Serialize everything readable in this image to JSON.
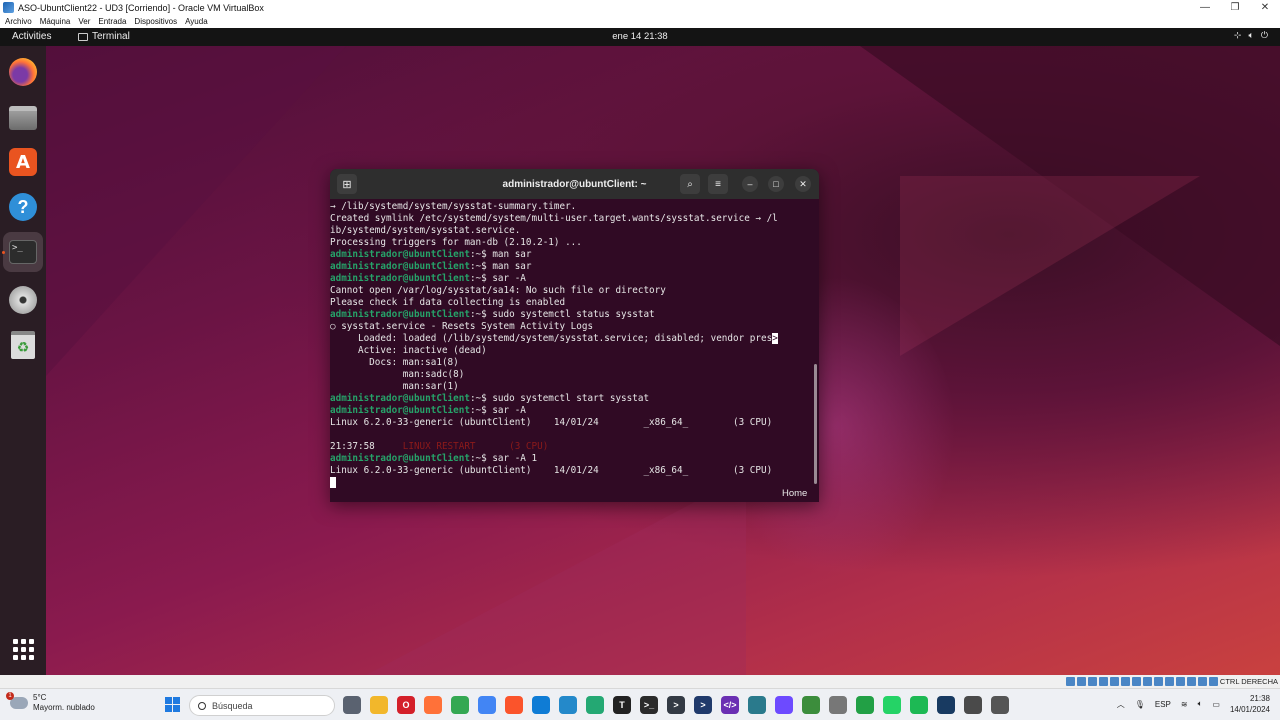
{
  "vbox": {
    "title": "ASO-UbuntClient22 - UD3 [Corriendo] - Oracle VM VirtualBox",
    "menu": [
      "Archivo",
      "Máquina",
      "Ver",
      "Entrada",
      "Dispositivos",
      "Ayuda"
    ],
    "host_key": "CTRL DERECHA"
  },
  "gnome": {
    "activities": "Activities",
    "app_name": "Terminal",
    "clock": "ene 14  21:38"
  },
  "dock": {
    "items": [
      "firefox-icon",
      "files-icon",
      "app-store-icon",
      "help-icon",
      "terminal-icon",
      "disc-icon",
      "trash-icon"
    ],
    "active": "terminal-icon"
  },
  "terminal": {
    "title": "administrador@ubuntClient: ~",
    "lines": [
      {
        "text": "→ /lib/systemd/system/sysstat-summary.timer."
      },
      {
        "text": "Created symlink /etc/systemd/system/multi-user.target.wants/sysstat.service → /l"
      },
      {
        "text": "ib/systemd/system/sysstat.service."
      },
      {
        "text": "Processing triggers for man-db (2.10.2-1) ..."
      },
      {
        "prompt": "administrador@ubuntClient",
        "cmd": ":~$ man sar"
      },
      {
        "prompt": "administrador@ubuntClient",
        "cmd": ":~$ man sar"
      },
      {
        "prompt": "administrador@ubuntClient",
        "cmd": ":~$ sar -A"
      },
      {
        "text": "Cannot open /var/log/sysstat/sa14: No such file or directory"
      },
      {
        "text": "Please check if data collecting is enabled"
      },
      {
        "prompt": "administrador@ubuntClient",
        "cmd": ":~$ sudo systemctl status sysstat"
      },
      {
        "text": "○ sysstat.service - Resets System Activity Logs"
      },
      {
        "text": "     Loaded: loaded (/lib/systemd/system/sysstat.service; disabled; vendor pres",
        "rv": ">"
      },
      {
        "text": "     Active: inactive (dead)"
      },
      {
        "text": "       Docs: man:sa1(8)"
      },
      {
        "text": "             man:sadc(8)"
      },
      {
        "text": "             man:sar(1)"
      },
      {
        "prompt": "administrador@ubuntClient",
        "cmd": ":~$ sudo systemctl start sysstat"
      },
      {
        "prompt": "administrador@ubuntClient",
        "cmd": ":~$ sar -A"
      },
      {
        "text": "Linux 6.2.0-33-generic (ubuntClient)    14/01/24        _x86_64_        (3 CPU)"
      },
      {
        "text": ""
      },
      {
        "time": "21:37:58",
        "restart": "     LINUX RESTART      (3 CPU)"
      },
      {
        "prompt": "administrador@ubuntClient",
        "cmd": ":~$ sar -A 1"
      },
      {
        "text": "Linux 6.2.0-33-generic (ubuntClient)    14/01/24        _x86_64_        (3 CPU)"
      },
      {
        "cursor": true
      }
    ]
  },
  "desktop": {
    "home_label": "Home"
  },
  "taskbar": {
    "weather_temp": "5°C",
    "weather_desc": "Mayorm. nublado",
    "weather_badge": "1",
    "search_placeholder": "Búsqueda",
    "lang": "ESP",
    "time": "21:38",
    "date": "14/01/2024",
    "apps": [
      {
        "name": "task-view-icon",
        "color": "#5a6270",
        "glyph": ""
      },
      {
        "name": "file-explorer-icon",
        "color": "#f2b72b",
        "glyph": ""
      },
      {
        "name": "opera-icon",
        "color": "#d4202a",
        "glyph": "O"
      },
      {
        "name": "firefox-icon",
        "color": "#ff7139",
        "glyph": ""
      },
      {
        "name": "chrome-icon",
        "color": "#34a853",
        "glyph": ""
      },
      {
        "name": "chrome-profile-icon",
        "color": "#4285f4",
        "glyph": ""
      },
      {
        "name": "brave-icon",
        "color": "#fb542b",
        "glyph": ""
      },
      {
        "name": "edge-icon",
        "color": "#0f7cd5",
        "glyph": ""
      },
      {
        "name": "vscode-icon",
        "color": "#2489ca",
        "glyph": ""
      },
      {
        "name": "vscode-insiders-icon",
        "color": "#24a873",
        "glyph": ""
      },
      {
        "name": "typora-icon",
        "color": "#222222",
        "glyph": "T"
      },
      {
        "name": "terminal-icon",
        "color": "#2b2b2b",
        "glyph": ">_"
      },
      {
        "name": "powershell-icon",
        "color": "#333a44",
        "glyph": ">"
      },
      {
        "name": "powershell-core-icon",
        "color": "#203a6b",
        "glyph": ">"
      },
      {
        "name": "dev-tools-icon",
        "color": "#6b2fb3",
        "glyph": "</>"
      },
      {
        "name": "paws-icon",
        "color": "#2a7a8c",
        "glyph": ""
      },
      {
        "name": "proton-icon",
        "color": "#6d4aff",
        "glyph": ""
      },
      {
        "name": "plant-icon",
        "color": "#3c8d3c",
        "glyph": ""
      },
      {
        "name": "puzzle-icon",
        "color": "#777777",
        "glyph": ""
      },
      {
        "name": "chat-icon",
        "color": "#22a045",
        "glyph": ""
      },
      {
        "name": "whatsapp-icon",
        "color": "#25d366",
        "glyph": ""
      },
      {
        "name": "spotify-icon",
        "color": "#1db954",
        "glyph": ""
      },
      {
        "name": "virtualbox-icon",
        "color": "#183a61",
        "glyph": ""
      },
      {
        "name": "virtualbox-vm-icon",
        "color": "#4a4a4a",
        "glyph": ""
      },
      {
        "name": "network-app-icon",
        "color": "#555555",
        "glyph": ""
      }
    ]
  }
}
